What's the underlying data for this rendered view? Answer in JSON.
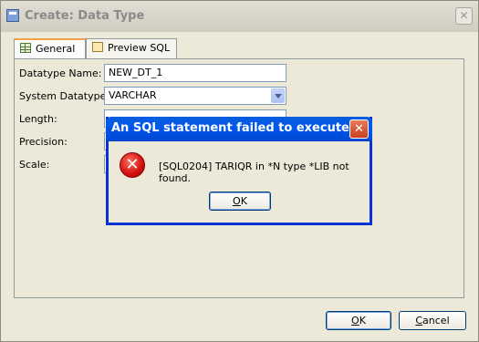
{
  "window": {
    "title": "Create: Data Type",
    "close": "✕"
  },
  "tabs": [
    {
      "label": "General",
      "icon": "grid-icon"
    },
    {
      "label": "Preview SQL",
      "icon": "sql-icon"
    }
  ],
  "form": {
    "datatype_name_label": "Datatype Name:",
    "datatype_name_value": "NEW_DT_1",
    "system_datatype_label": "System Datatype:",
    "system_datatype_value": "VARCHAR",
    "length_label": "Length:",
    "precision_label": "Precision:",
    "scale_label": "Scale:"
  },
  "footer": {
    "ok": "O",
    "ok_rest": "K",
    "cancel_pre": "",
    "cancel": "C",
    "cancel_rest": "ancel"
  },
  "error_dialog": {
    "title": "An SQL statement failed to execute.",
    "close": "✕",
    "icon": "error-icon",
    "message": "[SQL0204] TARIQR in *N type *LIB not found.",
    "ok": "O",
    "ok_rest": "K"
  },
  "colors": {
    "dialog_title": "#0058ee",
    "error": "#d01010",
    "tab_active_accent": "#f0a14a"
  }
}
